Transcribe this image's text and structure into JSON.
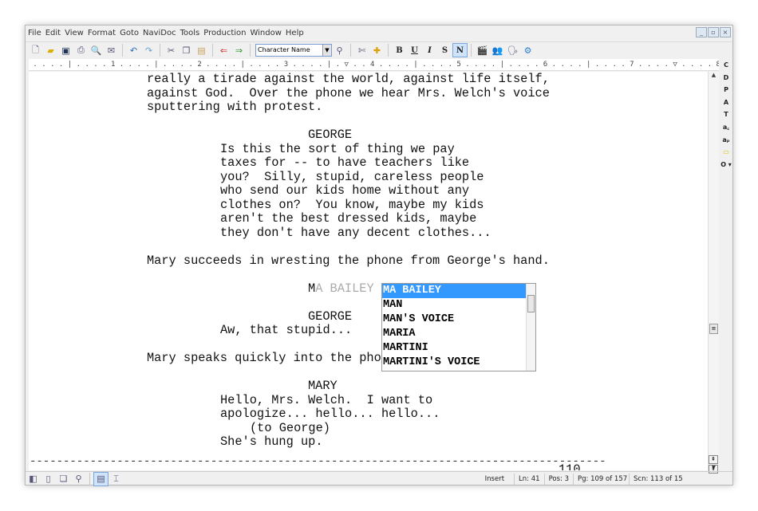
{
  "menu": [
    "File",
    "Edit",
    "View",
    "Format",
    "Goto",
    "NaviDoc",
    "Tools",
    "Production",
    "Window",
    "Help"
  ],
  "window_controls": [
    "_",
    "▫",
    "×"
  ],
  "toolbar": {
    "element_select": "Character Name",
    "format_buttons": [
      "B",
      "U",
      "I",
      "S",
      "N"
    ],
    "active_format": "N"
  },
  "ruler": " . . . . | . . . . 1 . . . . | . . . . 2 . . . . | . . . . 3 . . . . | . ▽ . . 4 . . . . | . . . . 5 . . . . | . . . . 6 . . . . | . . . . 7 . . . . ▽ . . . . 8 . . . . | . . . . 9 . . .",
  "sidebar": [
    "C",
    "D",
    "P",
    "A",
    "T",
    "a꜀",
    "aₚ",
    "▭",
    "O ▾"
  ],
  "script": [
    {
      "indent": "action",
      "text": "really a tirade against the world, against life itself,"
    },
    {
      "indent": "action",
      "text": "against God.  Over the phone we hear Mrs. Welch's voice"
    },
    {
      "indent": "action",
      "text": "sputtering with protest."
    },
    {
      "indent": "action",
      "text": ""
    },
    {
      "indent": "character",
      "text": "GEORGE"
    },
    {
      "indent": "dialogue",
      "text": "Is this the sort of thing we pay"
    },
    {
      "indent": "dialogue",
      "text": "taxes for -- to have teachers like"
    },
    {
      "indent": "dialogue",
      "text": "you?  Silly, stupid, careless people"
    },
    {
      "indent": "dialogue",
      "text": "who send our kids home without any"
    },
    {
      "indent": "dialogue",
      "text": "clothes on?  You know, maybe my kids"
    },
    {
      "indent": "dialogue",
      "text": "aren't the best dressed kids, maybe"
    },
    {
      "indent": "dialogue",
      "text": "they don't have any decent clothes..."
    },
    {
      "indent": "action",
      "text": ""
    },
    {
      "indent": "action",
      "text": "Mary succeeds in wresting the phone from George's hand."
    },
    {
      "indent": "action",
      "text": ""
    },
    {
      "indent": "character",
      "text": "M",
      "suggest": "A BAILEY"
    },
    {
      "indent": "action",
      "text": ""
    },
    {
      "indent": "character",
      "text": "GEORGE"
    },
    {
      "indent": "dialogue",
      "text": "Aw, that stupid..."
    },
    {
      "indent": "action",
      "text": ""
    },
    {
      "indent": "action",
      "text": "Mary speaks quickly into the phone."
    },
    {
      "indent": "action",
      "text": ""
    },
    {
      "indent": "character",
      "text": "MARY"
    },
    {
      "indent": "dialogue",
      "text": "Hello, Mrs. Welch.  I want to"
    },
    {
      "indent": "dialogue",
      "text": "apologize... hello... hello..."
    },
    {
      "indent": "paren",
      "text": "(to George)"
    },
    {
      "indent": "dialogue",
      "text": "She's hung up."
    }
  ],
  "page_break": "--------------------------------------------------------------------------------------",
  "page_number": "110",
  "autocomplete": {
    "items": [
      "MA BAILEY",
      "MAN",
      "MAN'S VOICE",
      "MARIA",
      "MARTINI",
      "MARTINI'S VOICE"
    ],
    "selected": 0
  },
  "status": {
    "mode": "Insert",
    "line": "Ln: 41",
    "pos": "Pos: 3",
    "page": "Pg: 109 of 157",
    "scene": "Scn: 113  of 15"
  },
  "colors": {
    "selection": "#3399ff",
    "active_button": "#cfe3fa"
  }
}
